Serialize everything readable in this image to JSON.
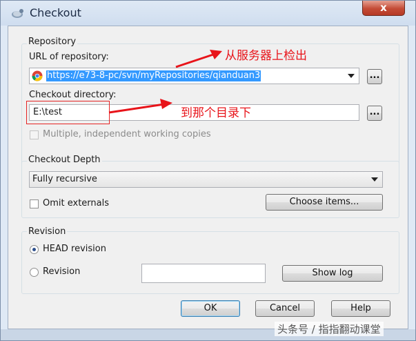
{
  "window": {
    "title": "Checkout",
    "close_label": "x"
  },
  "repository": {
    "legend": "Repository",
    "url_label": "URL of repository:",
    "url_value": "https://e73-8-pc/svn/myRepositories/qianduan3",
    "dir_label": "Checkout directory:",
    "dir_value": "E:\\test",
    "browse_label": "...",
    "multiple_label": "Multiple, independent working copies"
  },
  "depth": {
    "legend": "Checkout Depth",
    "value": "Fully recursive",
    "omit_label": "Omit externals",
    "choose_label": "Choose items..."
  },
  "revision": {
    "legend": "Revision",
    "head_label": "HEAD revision",
    "rev_label": "Revision",
    "show_log_label": "Show log"
  },
  "buttons": {
    "ok": "OK",
    "cancel": "Cancel",
    "help": "Help"
  },
  "annotations": {
    "from_server": "从服务器上检出",
    "to_dir": "到那个目录下"
  },
  "watermark": "头条号 / 指指翻动课堂",
  "colors": {
    "annotation": "#e8141a",
    "selection": "#3399ff",
    "close": "#c44b36"
  }
}
